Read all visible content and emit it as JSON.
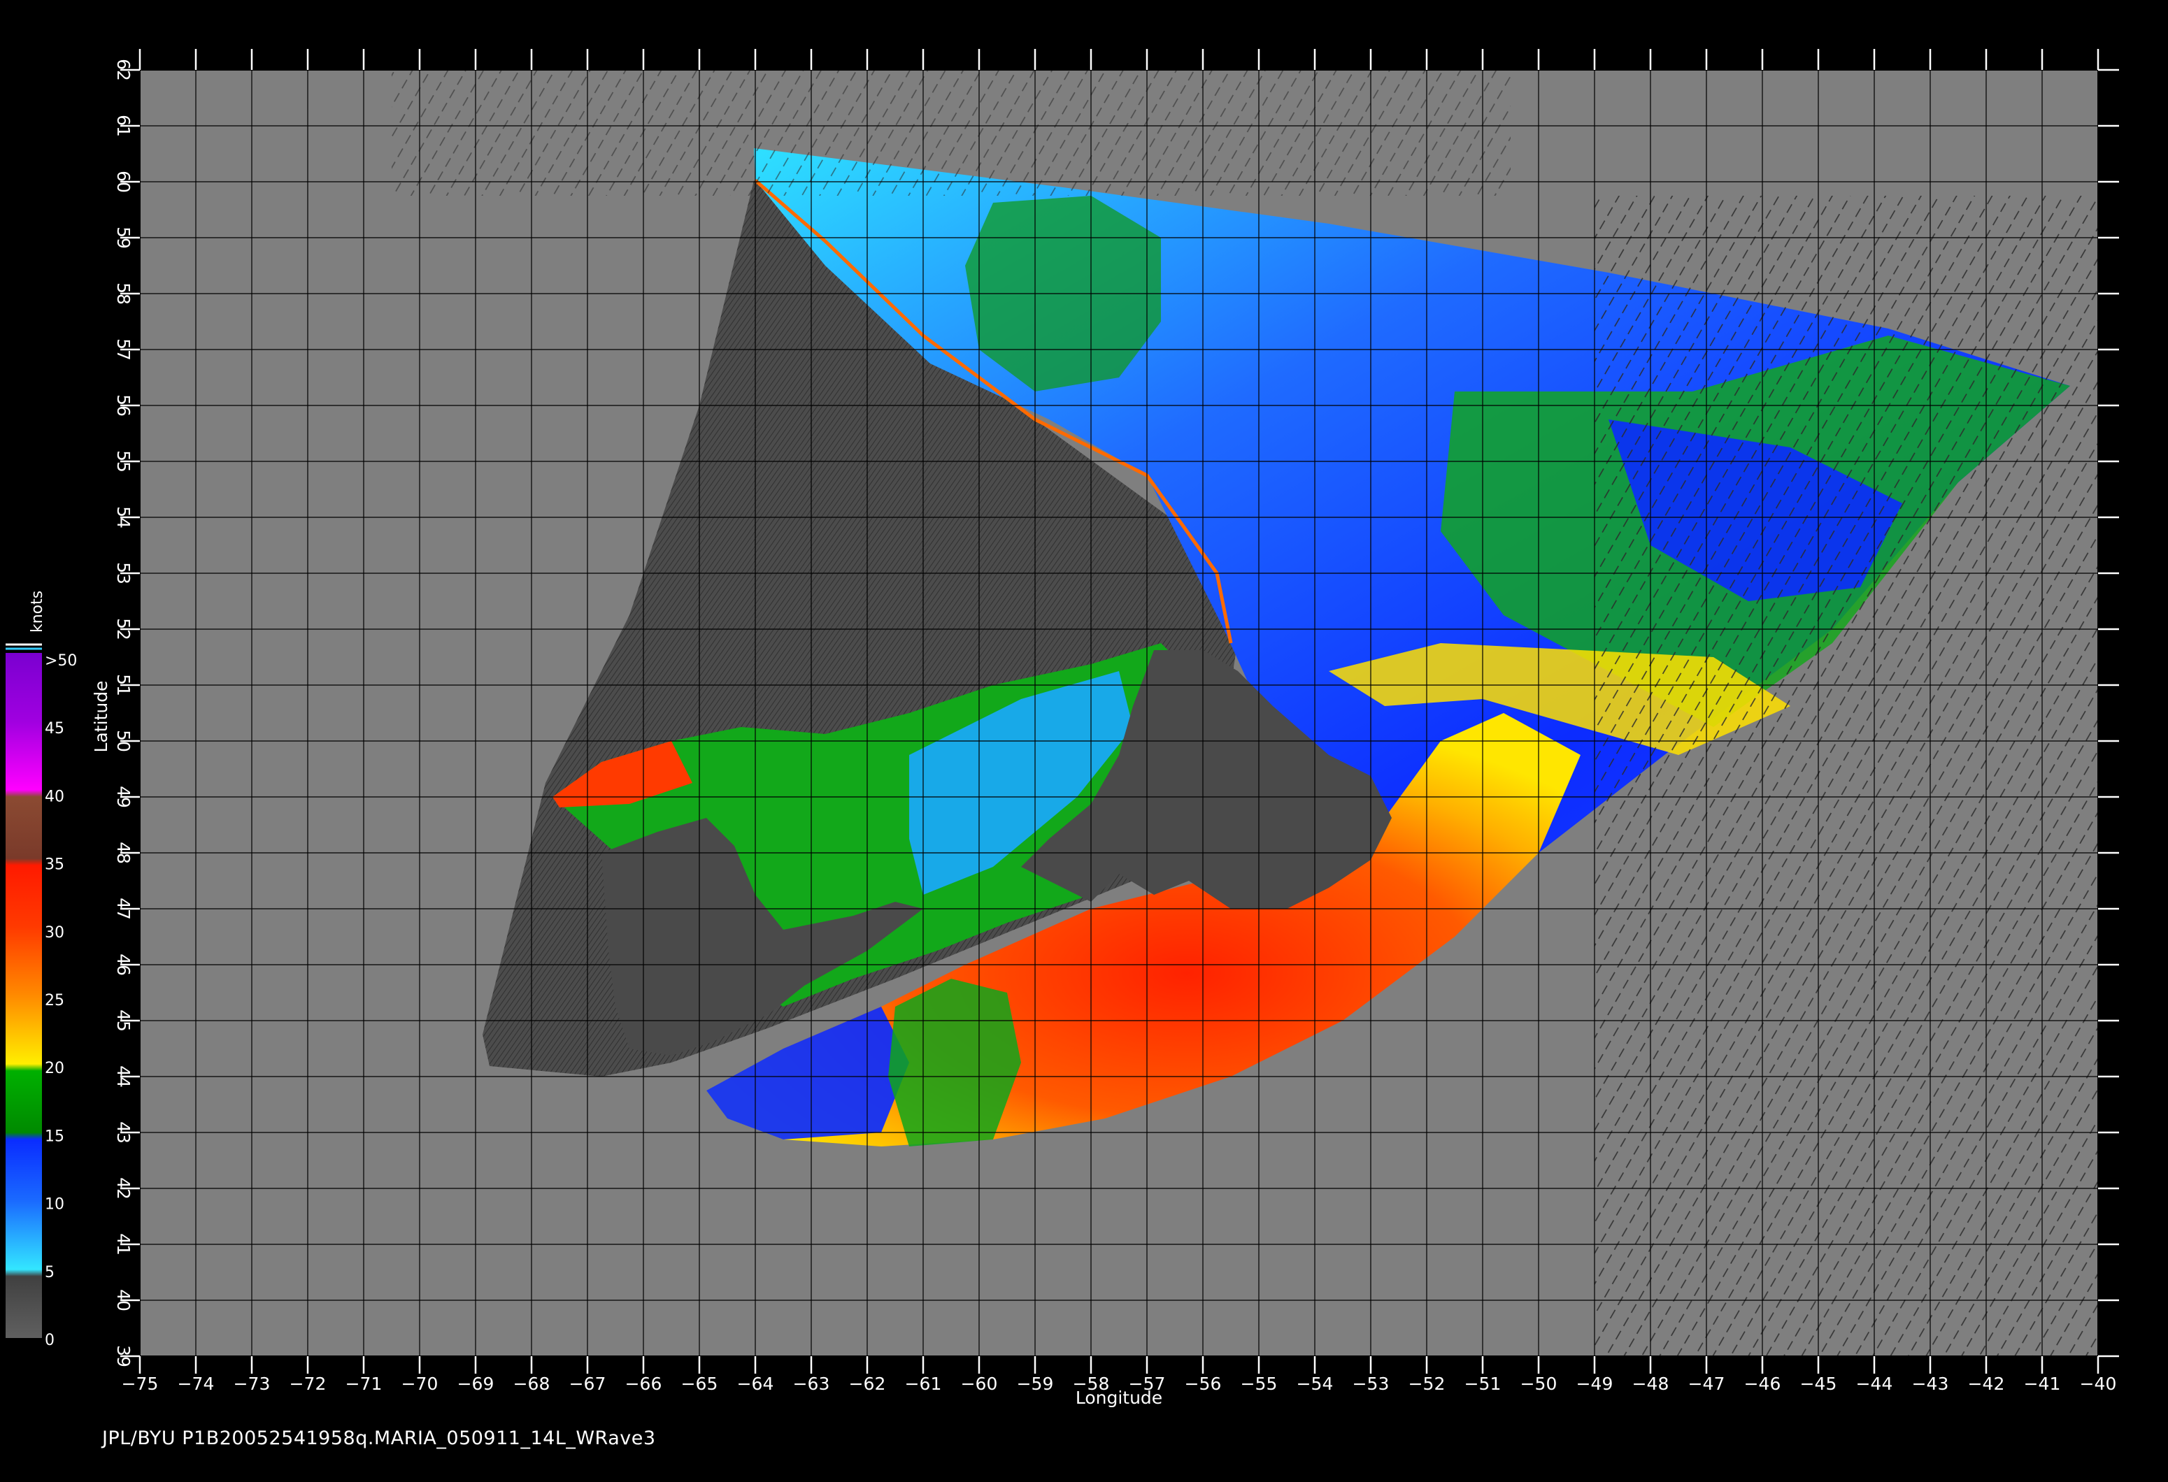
{
  "footer": {
    "caption": "JPL/BYU  P1B20052541958q.MARIA_050911_14L_WRave3"
  },
  "axes": {
    "xlabel": "Longitude",
    "ylabel": "Latitude",
    "lon_ticks": [
      -75,
      -74,
      -73,
      -72,
      -71,
      -70,
      -69,
      -68,
      -67,
      -66,
      -65,
      -64,
      -63,
      -62,
      -61,
      -60,
      -59,
      -58,
      -57,
      -56,
      -55,
      -54,
      -53,
      -52,
      -51,
      -50,
      -49,
      -48,
      -47,
      -46,
      -45,
      -44,
      -43,
      -42,
      -41,
      -40
    ],
    "lat_ticks": [
      39,
      40,
      41,
      42,
      43,
      44,
      45,
      46,
      47,
      48,
      49,
      50,
      51,
      52,
      53,
      54,
      55,
      56,
      57,
      58,
      59,
      60,
      61,
      62
    ],
    "lon_range": [
      -75,
      -40
    ],
    "lat_range": [
      39,
      62
    ],
    "grid": true
  },
  "legend": {
    "unit": "knots",
    "labels": [
      ">50",
      "45",
      "40",
      "35",
      "30",
      "25",
      "20",
      "15",
      "10",
      "5",
      "0"
    ],
    "colors": {
      "calm": "#505050",
      "light_blue": "#33e6ff",
      "blue": "#0a2cff",
      "green": "#0db30d",
      "yellow": "#ffea00",
      "orange": "#ff7a00",
      "red": "#ff1a00",
      "brown": "#8b4a32",
      "magenta": "#ff00ff",
      "purple": "#7a00d0"
    }
  },
  "colors": {
    "background": "#000000",
    "land": "#7f7f7f",
    "swath_land": "#4a4a4a",
    "grid": "#000000"
  }
}
